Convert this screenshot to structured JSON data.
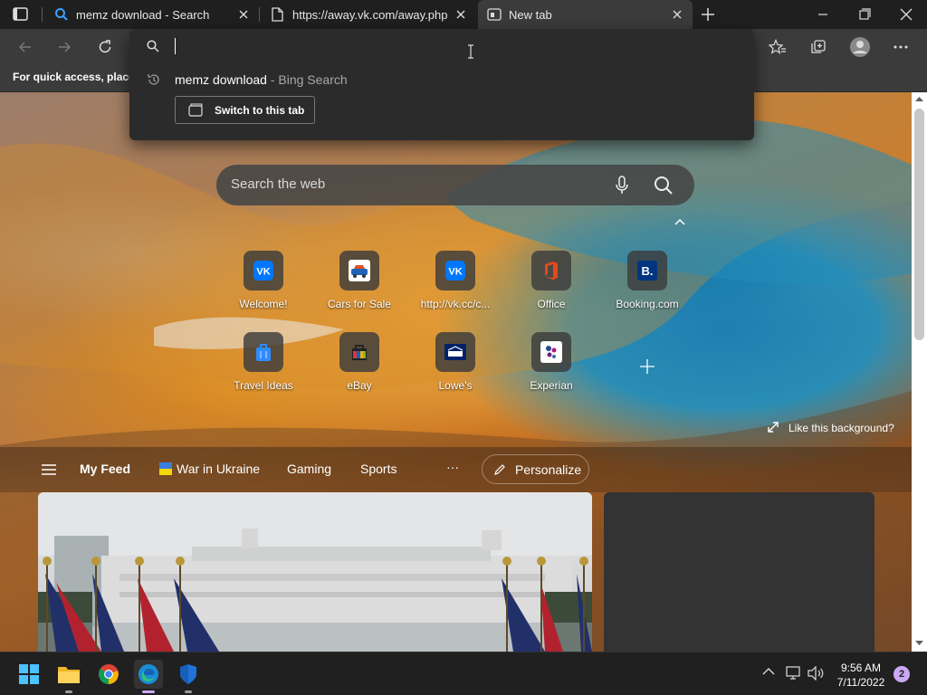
{
  "tabs": [
    {
      "title": "memz download - Search",
      "icon": "search-icon"
    },
    {
      "title": "https://away.vk.com/away.php",
      "icon": "page-icon"
    },
    {
      "title": "New tab",
      "icon": "newtab-icon"
    }
  ],
  "favorites_bar": {
    "hint": "For quick access, place y"
  },
  "omnibox": {
    "value": "",
    "suggestion_query": "memz download",
    "suggestion_source": "- Bing Search",
    "switch_label": "Switch to this tab"
  },
  "ntp": {
    "search_placeholder": "Search the web",
    "quick_links": [
      {
        "label": "Welcome!",
        "icon": "vk-icon"
      },
      {
        "label": "Cars for Sale",
        "icon": "cars-icon"
      },
      {
        "label": "http://vk.cc/c...",
        "icon": "vk-icon"
      },
      {
        "label": "Office",
        "icon": "office-icon"
      },
      {
        "label": "Booking.com",
        "icon": "booking-icon"
      },
      {
        "label": "Travel Ideas",
        "icon": "travel-bag-icon"
      },
      {
        "label": "eBay",
        "icon": "ebay-icon"
      },
      {
        "label": "Lowe's",
        "icon": "lowes-icon"
      },
      {
        "label": "Experian",
        "icon": "experian-icon"
      }
    ],
    "like_background": "Like this background?"
  },
  "feed": {
    "my_feed": "My Feed",
    "items": [
      "War in Ukraine",
      "Gaming",
      "Sports"
    ],
    "more": "···",
    "personalize": "Personalize"
  },
  "taskbar": {
    "time": "9:56 AM",
    "date": "7/11/2022",
    "notifications": "2"
  },
  "colors": {
    "tab_active": "#3b3b3b",
    "accent": "#0a84ff",
    "vk": "#0077ff",
    "booking": "#003580"
  }
}
